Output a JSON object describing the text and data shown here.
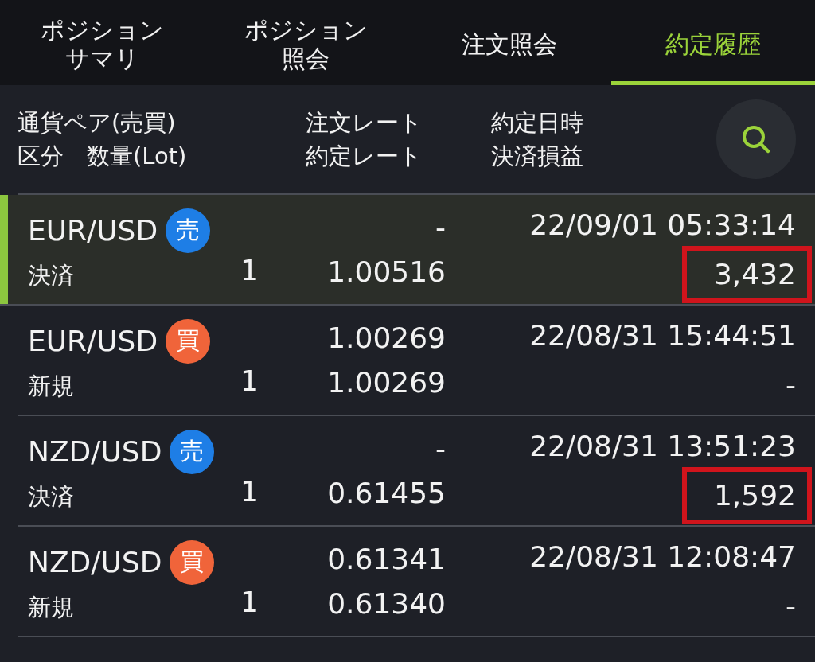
{
  "tabs": [
    {
      "label_lines": [
        "ポジション",
        "サマリ"
      ],
      "selected": false
    },
    {
      "label_lines": [
        "ポジション",
        "照会"
      ],
      "selected": false
    },
    {
      "label_lines": [
        "注文照会"
      ],
      "selected": false
    },
    {
      "label_lines": [
        "約定履歴"
      ],
      "selected": true
    }
  ],
  "header": {
    "col_1": [
      "通貨ペア(売買)",
      "区分　数量(Lot)"
    ],
    "col_2": [
      "注文レート",
      "約定レート"
    ],
    "col_3": [
      "約定日時",
      "決済損益"
    ]
  },
  "rows": [
    {
      "pair": "EUR/USD",
      "badge": {
        "label": "売",
        "color": "#1e7ee6"
      },
      "type": "決済",
      "lots": "1",
      "order_rate": "-",
      "exec_rate": "1.00516",
      "datetime": "22/09/01 05:33:14",
      "pnl": "3,432",
      "selected": true,
      "highlighted": true
    },
    {
      "pair": "EUR/USD",
      "badge": {
        "label": "買",
        "color": "#f0643a"
      },
      "type": "新規",
      "lots": "1",
      "order_rate": "1.00269",
      "exec_rate": "1.00269",
      "datetime": "22/08/31 15:44:51",
      "pnl": "-",
      "selected": false,
      "highlighted": false
    },
    {
      "pair": "NZD/USD",
      "badge": {
        "label": "売",
        "color": "#1e7ee6"
      },
      "type": "決済",
      "lots": "1",
      "order_rate": "-",
      "exec_rate": "0.61455",
      "datetime": "22/08/31 13:51:23",
      "pnl": "1,592",
      "selected": false,
      "highlighted": true
    },
    {
      "pair": "NZD/USD",
      "badge": {
        "label": "買",
        "color": "#f0643a"
      },
      "type": "新規",
      "lots": "1",
      "order_rate": "0.61341",
      "exec_rate": "0.61340",
      "datetime": "22/08/31 12:08:47",
      "pnl": "-",
      "selected": false,
      "highlighted": false
    }
  ]
}
